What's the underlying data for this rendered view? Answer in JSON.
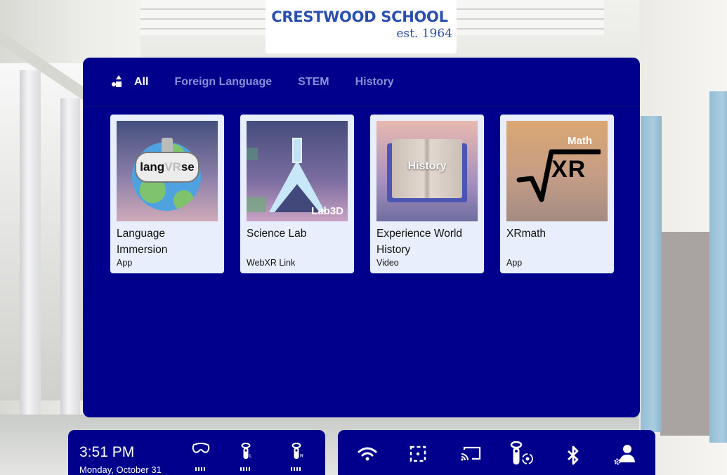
{
  "logo": {
    "name": "CRESTWOOD SCHOOL",
    "established": "est. 1964",
    "color": "#2a4fb0"
  },
  "panel": {
    "background": "#00008c",
    "filter_icon": "shapes-icon",
    "tabs": [
      {
        "label": "All",
        "active": true
      },
      {
        "label": "Foreign Language",
        "active": false
      },
      {
        "label": "STEM",
        "active": false
      },
      {
        "label": "History",
        "active": false
      }
    ],
    "cards": [
      {
        "title": "Language Immersion",
        "type": "App",
        "thumb_text": {
          "pre": "lang",
          "mid": "VR",
          "post": "se"
        }
      },
      {
        "title": "Science Lab",
        "type": "WebXR Link",
        "thumb_text": "Lab3D"
      },
      {
        "title": "Experience World History",
        "type": "Video",
        "thumb_text": "History"
      },
      {
        "title": "XRmath",
        "type": "App",
        "thumb_text": {
          "top": "Math",
          "main": "XR"
        }
      }
    ]
  },
  "status_bar": {
    "time": "3:51 PM",
    "date": "Monday, October 31",
    "devices": [
      {
        "name": "headset",
        "icon": "headset-icon",
        "label": ""
      },
      {
        "name": "left-controller",
        "icon": "controller-icon",
        "label": "L"
      },
      {
        "name": "right-controller",
        "icon": "controller-icon",
        "label": "R"
      }
    ]
  },
  "quick_settings": [
    {
      "name": "wifi",
      "icon": "wifi-icon"
    },
    {
      "name": "boundary",
      "icon": "boundary-icon"
    },
    {
      "name": "cast",
      "icon": "cast-icon"
    },
    {
      "name": "controller-settings",
      "icon": "controller-sync-icon"
    },
    {
      "name": "bluetooth",
      "icon": "bluetooth-icon"
    },
    {
      "name": "account-settings",
      "icon": "user-settings-icon"
    }
  ]
}
